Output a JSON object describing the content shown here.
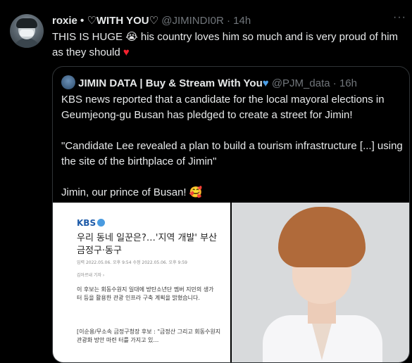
{
  "tweet": {
    "display_name": "roxie • ♡WITH YOU♡",
    "handle": "@JIMINDI0R",
    "separator": "·",
    "time": "14h",
    "more": "···",
    "text_before": "THIS IS HUGE ",
    "emoji_cry": "😭",
    "text_after": " his country loves him so much and is very proud of him as they should ",
    "emoji_heart": "♥",
    "heart_color": "#f4212e"
  },
  "quote": {
    "display_name": "JIMIN DATA | Buy & Stream With You",
    "heart": "♥",
    "handle": "@PJM_data",
    "separator": "·",
    "time": "16h",
    "para1": "KBS news reported that a candidate for the local mayoral elections in Geumjeong-gu Busan has pledged to create a street for Jimin!",
    "para2": "\"Candidate Lee revealed a plan to build a tourism infrastructure [...] using the site of the birthplace of Jimin\"",
    "para3": "Jimin, our prince of Busan! ",
    "emoji_love": "🥰"
  },
  "article": {
    "logo": "KBS",
    "headline": "우리 동네 일꾼은?…'지역 개발' 부산 금정구·동구",
    "meta": "입력 2022.05.06. 오후 9:54   수정 2022.05.06. 오후 9:59",
    "byline": "김아르내 기자 ›",
    "body1": "이 후보는 회동수원지 일대에 방탄소년단 멤버 지민의 생가 터 등을 활용한 관광 인프라 구축 계획을 밝혔습니다.",
    "body2": "[이순용/무소속 금정구청장 후보 : \"금정산 그리고 회동수원지 관광화 방안 마련 터를 가지고 있…"
  },
  "colors": {
    "background": "#000000",
    "text": "#e7e9ea",
    "muted": "#71767b",
    "border": "#2f3336",
    "verified_heart": "#4b9fe8"
  }
}
